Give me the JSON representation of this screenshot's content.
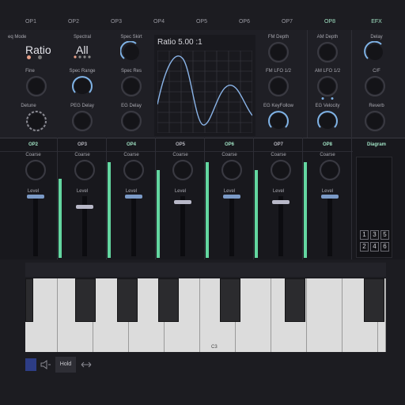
{
  "tabs": [
    "OP1",
    "OP2",
    "OP3",
    "OP4",
    "OP5",
    "OP6",
    "OP7",
    "OP8",
    "EFX"
  ],
  "active_tabs": [
    "OP8",
    "EFX"
  ],
  "op1": {
    "freq_mode_label": "eq Mode",
    "value": "Ratio",
    "fine_label": "Fine",
    "detune_label": "Detune"
  },
  "op2": {
    "spectral_label": "Spectral",
    "value": "All",
    "spec_range_label": "Spec Range",
    "peg_delay_label": "PEG Delay"
  },
  "op3": {
    "spec_skirt_label": "Spec Skirt",
    "spec_res_label": "Spec Res",
    "eg_delay_label": "EG Delay"
  },
  "display": {
    "title": "Ratio 5.00 :1"
  },
  "op7": {
    "fm_depth_label": "FM Depth",
    "fm_lfo_label": "FM LFO 1/2",
    "eg_keyfollow_label": "EG KeyFollow"
  },
  "op8": {
    "am_depth_label": "AM Depth",
    "am_lfo_label": "AM LFO 1/2",
    "eg_velocity_label": "EG Velocity"
  },
  "efx": {
    "delay_label": "Delay",
    "cf_label": "C/F",
    "reverb_label": "Reverb"
  },
  "mixer": {
    "channels": [
      {
        "name": "OP2",
        "active": true,
        "coarse_label": "Coarse",
        "level_label": "Level"
      },
      {
        "name": "OP3",
        "active": false,
        "coarse_label": "Coarse",
        "level_label": "Level"
      },
      {
        "name": "OP4",
        "active": true,
        "coarse_label": "Coarse",
        "level_label": "Level"
      },
      {
        "name": "OP5",
        "active": false,
        "coarse_label": "Coarse",
        "level_label": "Level"
      },
      {
        "name": "OP6",
        "active": true,
        "coarse_label": "Coarse",
        "level_label": "Level"
      },
      {
        "name": "OP7",
        "active": false,
        "coarse_label": "Coarse",
        "level_label": "Level"
      },
      {
        "name": "OP8",
        "active": true,
        "coarse_label": "Coarse",
        "level_label": "Level"
      }
    ],
    "diagram_label": "Diagram",
    "diagram_numbers": [
      "1",
      "3",
      "5",
      "2",
      "4",
      "6"
    ]
  },
  "keyboard": {
    "c3_label": "C3"
  },
  "bottom": {
    "hold_label": "Hold"
  },
  "colors": {
    "accent": "#63d6a0",
    "knob_ring": "#7fb3e6",
    "handle": "#7b9ac7"
  }
}
